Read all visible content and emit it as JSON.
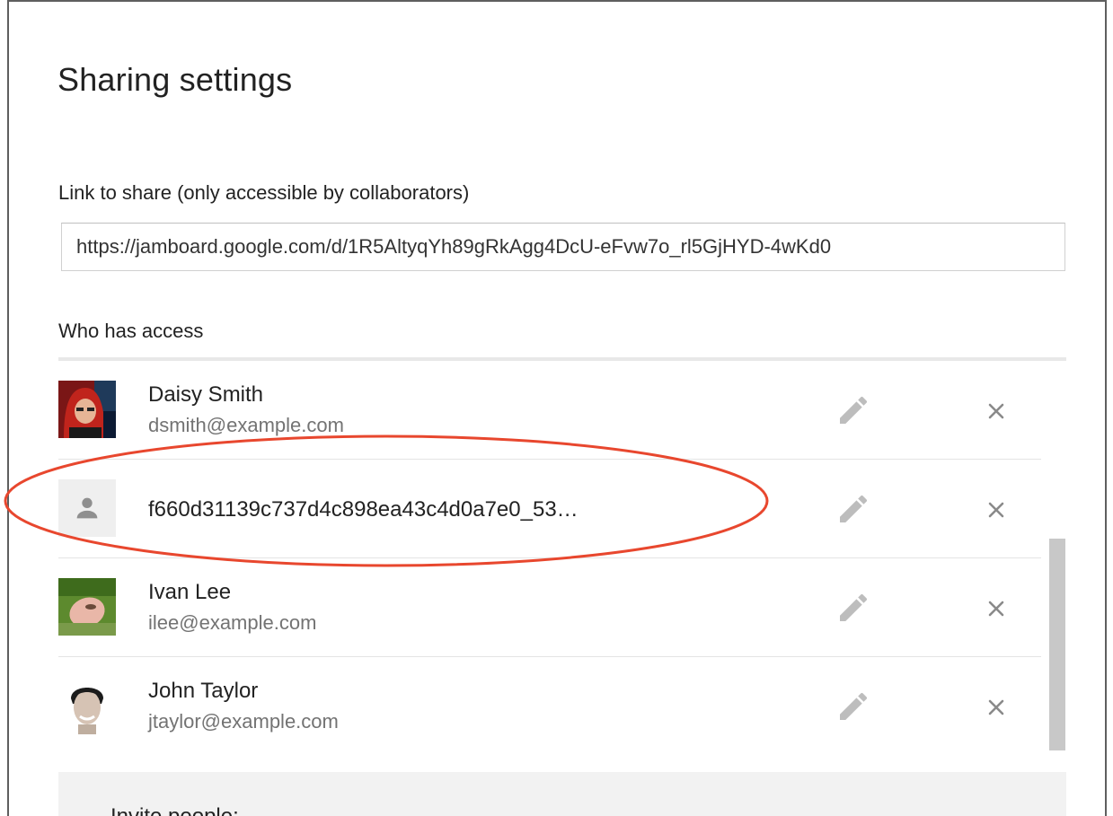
{
  "dialog": {
    "title": "Sharing settings",
    "link_label": "Link to share (only accessible by collaborators)",
    "link_value": "https://jamboard.google.com/d/1R5AltyqYh89gRkAgg4DcU-eFvw7o_rl5GjHYD-4wKd0",
    "access_label": "Who has access",
    "invite_label": "Invite people:"
  },
  "people": [
    {
      "name": "Daisy Smith",
      "email": "dsmith@example.com"
    },
    {
      "name": "f660d31139c737d4c898ea43c4d0a7e0_53…",
      "email": ""
    },
    {
      "name": "Ivan Lee",
      "email": "ilee@example.com"
    },
    {
      "name": "John Taylor",
      "email": "jtaylor@example.com"
    }
  ],
  "colors": {
    "highlight": "#e8472e",
    "icon_gray": "#bdbdbd",
    "scrollbar": "#c8c8c8"
  },
  "icons": {
    "edit": "pencil-icon",
    "remove": "close-icon",
    "generic_avatar": "person-icon"
  }
}
